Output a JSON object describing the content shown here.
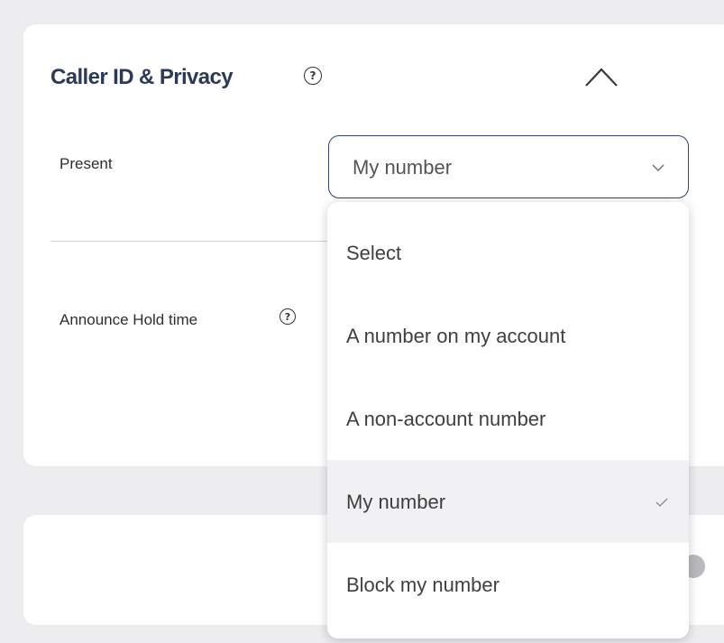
{
  "section": {
    "title": "Caller ID & Privacy",
    "help_glyph": "?"
  },
  "present": {
    "label": "Present",
    "selected_value": "My number"
  },
  "hold": {
    "label": "Announce Hold time",
    "help_glyph": "?"
  },
  "dropdown": {
    "options": [
      {
        "label": "Select",
        "selected": false
      },
      {
        "label": "A number on my account",
        "selected": false
      },
      {
        "label": "A non-account number",
        "selected": false
      },
      {
        "label": "My number",
        "selected": true
      },
      {
        "label": "Block my number",
        "selected": false
      }
    ]
  },
  "icons": {
    "help": "help-circle-icon",
    "collapse": "chevron-up-icon",
    "select_arrow": "chevron-down-icon",
    "selected_marker": "checkmark-icon"
  },
  "colors": {
    "page_background": "#ededf0",
    "card_background": "#ffffff",
    "title": "#2c3a5a",
    "select_border": "#2f4570",
    "selected_option_background": "#f1f1f3",
    "toggle_knob": "#b9b9be"
  }
}
